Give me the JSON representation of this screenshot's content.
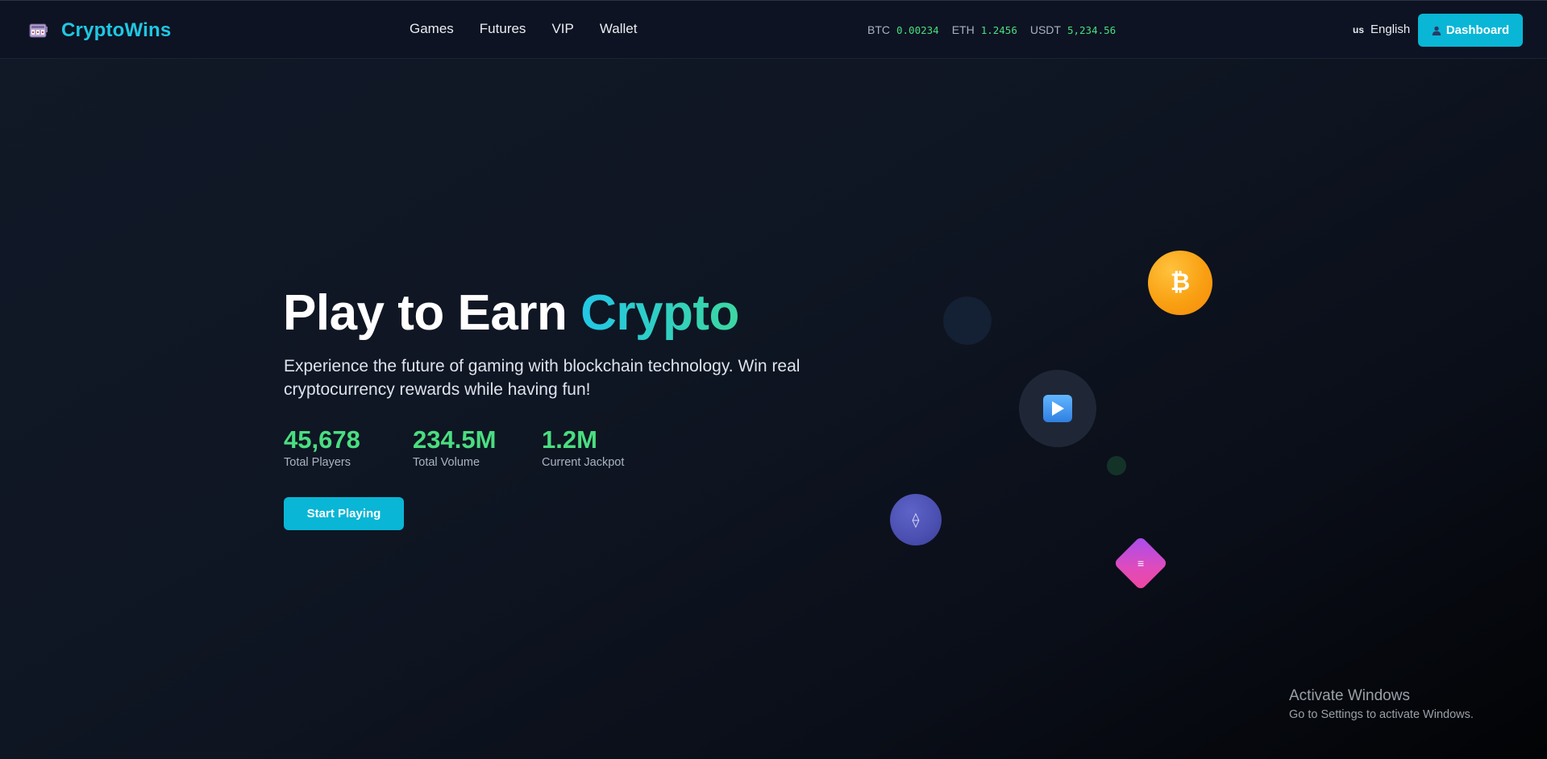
{
  "header": {
    "brand": "CryptoWins",
    "nav": [
      "Games",
      "Futures",
      "VIP",
      "Wallet"
    ],
    "ticker": [
      {
        "symbol": "BTC",
        "value": "0.00234"
      },
      {
        "symbol": "ETH",
        "value": "1.2456"
      },
      {
        "symbol": "USDT",
        "value": "5,234.56"
      }
    ],
    "language": {
      "flag": "us",
      "label": "English"
    },
    "dashboard_label": "Dashboard"
  },
  "hero": {
    "title_main": "Play to Earn ",
    "title_accent": "Crypto",
    "subtitle": "Experience the future of gaming with blockchain technology. Win real cryptocurrency rewards while having fun!",
    "stats": [
      {
        "value": "45,678",
        "label": "Total Players"
      },
      {
        "value": "234.5M",
        "label": "Total Volume"
      },
      {
        "value": "1.2M",
        "label": "Current Jackpot"
      }
    ],
    "cta": "Start Playing"
  },
  "graphics": {
    "btc_symbol": "₿",
    "eth_symbol": "⟠",
    "sol_symbol": "≡"
  },
  "watermark": {
    "title": "Activate Windows",
    "subtitle": "Go to Settings to activate Windows."
  },
  "colors": {
    "accent": "#09b6d6",
    "brand": "#1fc8e3",
    "positive": "#4ade80",
    "background": "#0d1322"
  }
}
